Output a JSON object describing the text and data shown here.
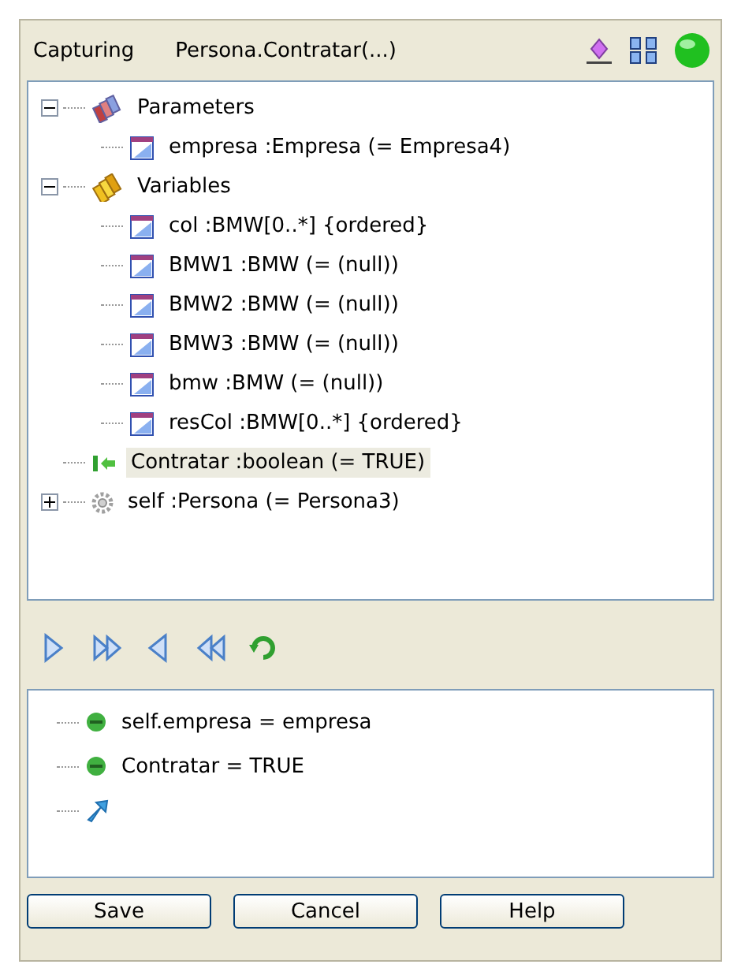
{
  "header": {
    "mode": "Capturing",
    "operation": "Persona.Contratar(...)"
  },
  "tree": [
    {
      "kind": "parameters",
      "label": "Parameters",
      "expanded": true,
      "selected": false,
      "children": [
        {
          "kind": "attribute",
          "label": "empresa :Empresa (= Empresa4)",
          "selected": false
        }
      ]
    },
    {
      "kind": "variables",
      "label": "Variables",
      "expanded": true,
      "selected": false,
      "children": [
        {
          "kind": "attribute",
          "label": "col :BMW[0..*] {ordered}",
          "selected": false
        },
        {
          "kind": "attribute",
          "label": "BMW1 :BMW (= (null))",
          "selected": false
        },
        {
          "kind": "attribute",
          "label": "BMW2 :BMW (= (null))",
          "selected": false
        },
        {
          "kind": "attribute",
          "label": "BMW3 :BMW (= (null))",
          "selected": false
        },
        {
          "kind": "attribute",
          "label": "bmw :BMW (= (null))",
          "selected": false
        },
        {
          "kind": "attribute",
          "label": "resCol :BMW[0..*] {ordered}",
          "selected": false
        }
      ]
    },
    {
      "kind": "result",
      "label": "Contratar :boolean (= TRUE)",
      "selected": true
    },
    {
      "kind": "object",
      "label": "self :Persona (= Persona3)",
      "expanded": false,
      "selected": false
    }
  ],
  "conditions": [
    {
      "kind": "ok",
      "label": "self.empresa = empresa"
    },
    {
      "kind": "ok",
      "label": "Contratar = TRUE"
    },
    {
      "kind": "new"
    }
  ],
  "buttons": [
    "Save",
    "Cancel",
    "Help"
  ]
}
